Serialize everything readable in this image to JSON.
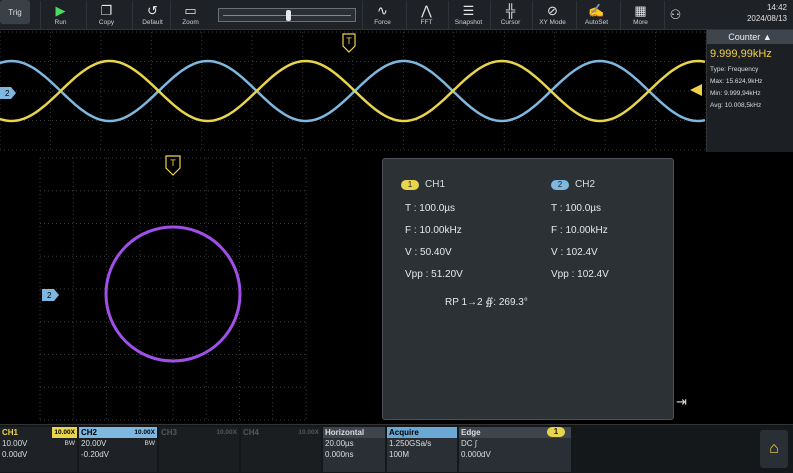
{
  "toolbar": {
    "trig_label": "Trig",
    "buttons": [
      {
        "label": "Run",
        "icon": "play-icon",
        "glyph": "▶"
      },
      {
        "label": "Copy",
        "icon": "copy-icon",
        "glyph": "❐"
      },
      {
        "label": "Default",
        "icon": "reset-icon",
        "glyph": "↺"
      },
      {
        "label": "Zoom",
        "icon": "zoom-icon",
        "glyph": "▭"
      },
      {
        "label": "Force",
        "icon": "force-icon",
        "glyph": "∿"
      },
      {
        "label": "FFT",
        "icon": "fft-icon",
        "glyph": "⋀"
      },
      {
        "label": "Snapshot",
        "icon": "snapshot-icon",
        "glyph": "☰"
      },
      {
        "label": "Cursor",
        "icon": "cursor-icon",
        "glyph": "╬"
      },
      {
        "label": "XY Mode",
        "icon": "xy-mode-icon",
        "glyph": "⊘"
      },
      {
        "label": "AutoSet",
        "icon": "autoset-icon",
        "glyph": "✍"
      },
      {
        "label": "More",
        "icon": "more-icon",
        "glyph": "▦"
      }
    ],
    "slider_value": 0.5,
    "clock_time": "14:42",
    "clock_date": "2024/08/13"
  },
  "colors": {
    "ch1": "#e8d44d",
    "ch2": "#7eb8e0",
    "xy": "#a050e8",
    "panel": "#2c3135",
    "accent": "#f0d24a"
  },
  "markers": {
    "trigger_top": "T",
    "trigger_xy": "T",
    "ch2_marker": "2"
  },
  "counter": {
    "title": "Counter",
    "value": "9.999,99kHz",
    "rows": [
      "Type: Frequency",
      "Max: 15.624,9kHz",
      "Min: 9.999,94kHz",
      "Avg: 10.008,5kHz"
    ]
  },
  "measure": {
    "ch1": {
      "badge": "1",
      "name": "CH1",
      "t": "T : 100.0µs",
      "f": "F : 10.00kHz",
      "v": "V : 50.40V",
      "vpp": "Vpp : 51.20V"
    },
    "ch2": {
      "badge": "2",
      "name": "CH2",
      "t": "T : 100.0µs",
      "f": "F : 10.00kHz",
      "v": "V : 102.4V",
      "vpp": "Vpp : 102.4V"
    },
    "phase": "RP 1→2 ∯: 269.3°"
  },
  "bottom": {
    "ch1": {
      "name": "CH1",
      "tag": "10.00X",
      "line1": "10.00V",
      "line1b": "BW",
      "line2": "0.00dV"
    },
    "ch2": {
      "name": "CH2",
      "tag": "10.00X",
      "line1": "20.00V",
      "line1b": "BW",
      "line2": "-0.20dV"
    },
    "ch3": {
      "name": "CH3",
      "tag": "10.00X"
    },
    "ch4": {
      "name": "CH4",
      "tag": "10.00X"
    },
    "horizontal": {
      "name": "Horizontal",
      "line1": "20.00µs",
      "line2": "0.000ns"
    },
    "acquire": {
      "name": "Acquire",
      "line1": "1.250GSa/s",
      "line2": "100M"
    },
    "edge": {
      "name": "Edge",
      "badge": "1",
      "line1": "DC ∫",
      "line2": "0.000dV"
    }
  }
}
